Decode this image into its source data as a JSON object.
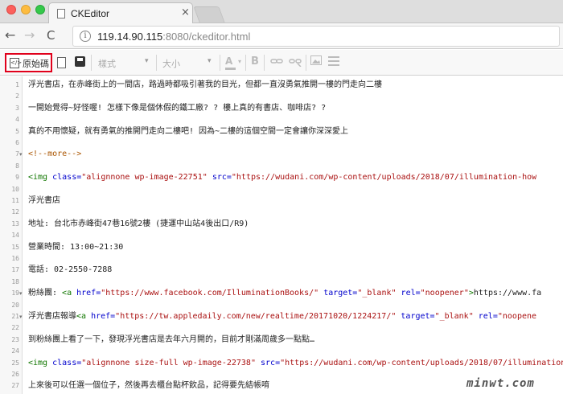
{
  "browser": {
    "tab_title": "CKEditor",
    "tab_close": "×",
    "url_host": "119.14.90.115",
    "url_rest": ":8080/ckeditor.html",
    "nav_back": "←",
    "nav_forward": "→",
    "nav_reload": "C",
    "info": "i"
  },
  "toolbar": {
    "source_label": "原始碼",
    "style_label": "樣式",
    "size_label": "大小",
    "text_color_label": "A",
    "bold_label": "B",
    "combo_arrow": "▾"
  },
  "editor": {
    "lines": [
      {
        "n": "1",
        "fold": "",
        "segments": [
          {
            "t": "浮光書店，在赤峰街上的一間店，路過時都吸引著我的目光，但都一直沒勇氣推開一樓的門走向二樓",
            "c": ""
          }
        ]
      },
      {
        "n": "2",
        "fold": "",
        "segments": []
      },
      {
        "n": "3",
        "fold": "",
        "segments": [
          {
            "t": "一開始覺得~好怪喔! 怎樣下像是個休假的鐵工廠? ? 樓上真的有書店、咖啡店? ?",
            "c": ""
          }
        ]
      },
      {
        "n": "4",
        "fold": "",
        "segments": []
      },
      {
        "n": "5",
        "fold": "",
        "segments": [
          {
            "t": "真的不用懷疑，就有勇氣的推開門走向二樓吧! 因為~二樓的這個空間一定會讓你深深愛上",
            "c": ""
          }
        ]
      },
      {
        "n": "6",
        "fold": "",
        "segments": []
      },
      {
        "n": "7",
        "fold": "▾",
        "segments": [
          {
            "t": "<!--more-->",
            "c": "cmt"
          }
        ]
      },
      {
        "n": "8",
        "fold": "",
        "segments": []
      },
      {
        "n": "9",
        "fold": "",
        "segments": [
          {
            "t": "<img ",
            "c": "tag"
          },
          {
            "t": "class=",
            "c": "attr"
          },
          {
            "t": "\"alignnone  wp-image-22751\"",
            "c": "str"
          },
          {
            "t": " ",
            "c": ""
          },
          {
            "t": "src=",
            "c": "attr"
          },
          {
            "t": "\"https://wudani.com/wp-content/uploads/2018/07/illumination-how",
            "c": "str"
          }
        ]
      },
      {
        "n": "10",
        "fold": "",
        "segments": []
      },
      {
        "n": "11",
        "fold": "",
        "segments": [
          {
            "t": "浮光書店",
            "c": ""
          }
        ]
      },
      {
        "n": "12",
        "fold": "",
        "segments": []
      },
      {
        "n": "13",
        "fold": "",
        "segments": [
          {
            "t": "地址: 台北市赤峰街47巷16號2樓 (捷運中山站4後出口/R9)",
            "c": ""
          }
        ]
      },
      {
        "n": "14",
        "fold": "",
        "segments": []
      },
      {
        "n": "15",
        "fold": "",
        "segments": [
          {
            "t": "營業時間: 13:00~21:30",
            "c": ""
          }
        ]
      },
      {
        "n": "16",
        "fold": "",
        "segments": []
      },
      {
        "n": "17",
        "fold": "",
        "segments": [
          {
            "t": "電話: 02-2550-7288",
            "c": ""
          }
        ]
      },
      {
        "n": "18",
        "fold": "",
        "segments": []
      },
      {
        "n": "19",
        "fold": "▾",
        "segments": [
          {
            "t": "粉絲團: ",
            "c": ""
          },
          {
            "t": "<a ",
            "c": "tag"
          },
          {
            "t": "href=",
            "c": "attr"
          },
          {
            "t": "\"https://www.facebook.com/IlluminationBooks/\"",
            "c": "str"
          },
          {
            "t": " ",
            "c": ""
          },
          {
            "t": "target=",
            "c": "attr"
          },
          {
            "t": "\"_blank\"",
            "c": "str"
          },
          {
            "t": " ",
            "c": ""
          },
          {
            "t": "rel=",
            "c": "attr"
          },
          {
            "t": "\"noopener\"",
            "c": "str"
          },
          {
            "t": ">",
            "c": "tag"
          },
          {
            "t": "https://www.fa",
            "c": ""
          }
        ]
      },
      {
        "n": "20",
        "fold": "",
        "segments": []
      },
      {
        "n": "21",
        "fold": "▾",
        "segments": [
          {
            "t": "浮光書店報導",
            "c": ""
          },
          {
            "t": "<a ",
            "c": "tag"
          },
          {
            "t": "href=",
            "c": "attr"
          },
          {
            "t": "\"https://tw.appledaily.com/new/realtime/20171020/1224217/\"",
            "c": "str"
          },
          {
            "t": " ",
            "c": ""
          },
          {
            "t": "target=",
            "c": "attr"
          },
          {
            "t": "\"_blank\"",
            "c": "str"
          },
          {
            "t": " ",
            "c": ""
          },
          {
            "t": "rel=",
            "c": "attr"
          },
          {
            "t": "\"noopene",
            "c": "str"
          }
        ]
      },
      {
        "n": "22",
        "fold": "",
        "segments": []
      },
      {
        "n": "23",
        "fold": "",
        "segments": [
          {
            "t": "到粉絲團上看了一下，發現浮光書店是去年六月開的，目前才剛滿周歲多一點點…",
            "c": ""
          }
        ]
      },
      {
        "n": "24",
        "fold": "",
        "segments": []
      },
      {
        "n": "25",
        "fold": "",
        "segments": [
          {
            "t": "<img ",
            "c": "tag"
          },
          {
            "t": "class=",
            "c": "attr"
          },
          {
            "t": "\"alignnone size-full wp-image-22738\"",
            "c": "str"
          },
          {
            "t": " ",
            "c": ""
          },
          {
            "t": "src=",
            "c": "attr"
          },
          {
            "t": "\"https://wudani.com/wp-content/uploads/2018/07/illumination-",
            "c": "str"
          }
        ]
      },
      {
        "n": "26",
        "fold": "",
        "segments": []
      },
      {
        "n": "27",
        "fold": "",
        "segments": [
          {
            "t": "上來後可以任選一個位子，然後再去櫃台點杯飲品，記得要先結帳唷",
            "c": ""
          }
        ]
      }
    ]
  },
  "watermark": "minwt.com"
}
